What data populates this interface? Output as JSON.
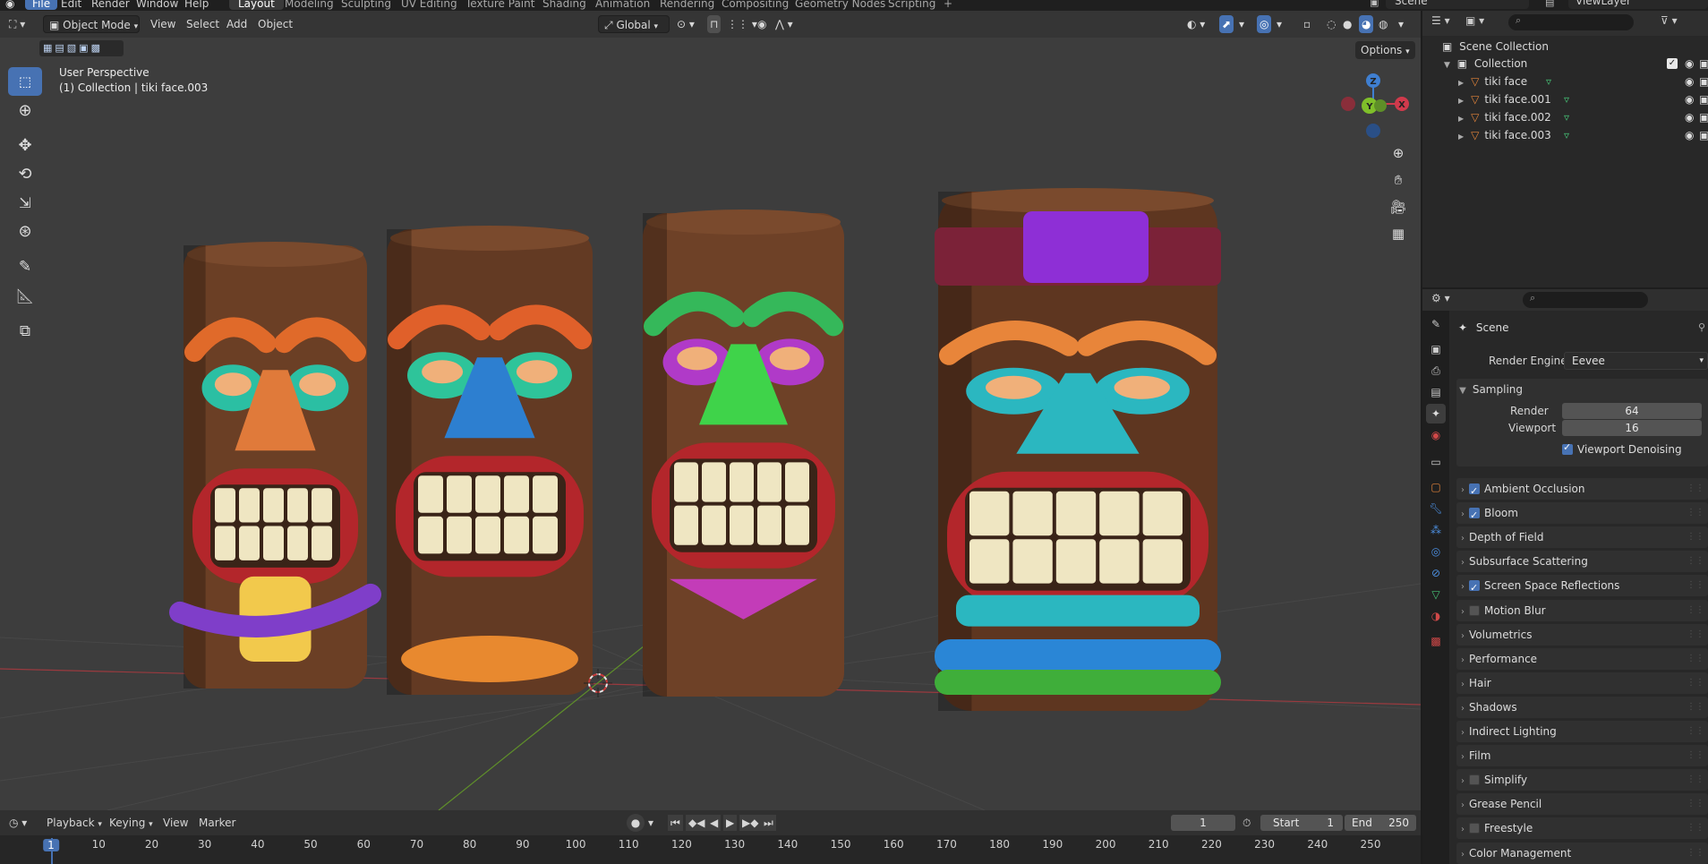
{
  "topbar": {
    "menus": [
      "File",
      "Edit",
      "Render",
      "Window",
      "Help"
    ],
    "workspaces": [
      "Layout",
      "Modeling",
      "Sculpting",
      "UV Editing",
      "Texture Paint",
      "Shading",
      "Animation",
      "Rendering",
      "Compositing",
      "Geometry Nodes",
      "Scripting"
    ],
    "active_workspace": "Layout",
    "add_workspace": "+",
    "scene_name": "Scene",
    "view_layer": "ViewLayer"
  },
  "viewport": {
    "mode": "Object Mode",
    "menus": [
      "View",
      "Select",
      "Add",
      "Object"
    ],
    "orientation": "Global",
    "options_label": "Options",
    "perspective_text": "User Perspective",
    "collection_text": "(1) Collection | tiki face.003",
    "gizmo": {
      "x": "X",
      "y": "Y",
      "z": "Z"
    },
    "tools": [
      "select-box-tool",
      "cursor-tool",
      "move-tool",
      "rotate-tool",
      "scale-tool",
      "transform-tool",
      "annotate-tool",
      "measure-tool",
      "add-cube-tool"
    ],
    "totems": [
      {
        "name": "tiki face",
        "wood": "#6b3f25",
        "brow": "#e06a2a",
        "eyes": "#2bbfa3",
        "nose": "#e07a3a",
        "lips": "#b3262b",
        "accent": "#7f3ec9",
        "chin": "#f2c94c"
      },
      {
        "name": "tiki face.001",
        "wood": "#633a23",
        "brow": "#e0602a",
        "eyes": "#2ec49a",
        "nose": "#2d7fd0",
        "lips": "#b3262b",
        "accent": "#e8892f",
        "chin": "#e8892f"
      },
      {
        "name": "tiki face.002",
        "wood": "#6e4127",
        "brow": "#35b85a",
        "eyes": "#b03ac8",
        "nose": "#3fd34a",
        "lips": "#b3262b",
        "accent": "#b03ac8",
        "chin": "#c33cb8"
      },
      {
        "name": "tiki face.003",
        "wood": "#5e3620",
        "brow": "#e8853a",
        "eyes": "#2bb7c0",
        "nose": "#2bb7c0",
        "lips": "#b3262b",
        "accent": "#8e2fd6",
        "chin": "#2a86d6"
      }
    ]
  },
  "outliner": {
    "root": "Scene Collection",
    "collection": "Collection",
    "objects": [
      "tiki face",
      "tiki face.001",
      "tiki face.002",
      "tiki face.003"
    ]
  },
  "properties": {
    "context": "Scene",
    "render_engine_label": "Render Engine",
    "render_engine": "Eevee",
    "sampling": {
      "title": "Sampling",
      "render_label": "Render",
      "render_value": "64",
      "viewport_label": "Viewport",
      "viewport_value": "16",
      "denoise_label": "Viewport Denoising"
    },
    "panels": [
      {
        "label": "Ambient Occlusion",
        "checkbox": "on"
      },
      {
        "label": "Bloom",
        "checkbox": "on"
      },
      {
        "label": "Depth of Field",
        "checkbox": "none"
      },
      {
        "label": "Subsurface Scattering",
        "checkbox": "none"
      },
      {
        "label": "Screen Space Reflections",
        "checkbox": "on"
      },
      {
        "label": "Motion Blur",
        "checkbox": "off"
      },
      {
        "label": "Volumetrics",
        "checkbox": "none"
      },
      {
        "label": "Performance",
        "checkbox": "none"
      },
      {
        "label": "Hair",
        "checkbox": "none"
      },
      {
        "label": "Shadows",
        "checkbox": "none"
      },
      {
        "label": "Indirect Lighting",
        "checkbox": "none"
      },
      {
        "label": "Film",
        "checkbox": "none"
      },
      {
        "label": "Simplify",
        "checkbox": "off"
      },
      {
        "label": "Grease Pencil",
        "checkbox": "none"
      },
      {
        "label": "Freestyle",
        "checkbox": "off"
      },
      {
        "label": "Color Management",
        "checkbox": "none"
      }
    ]
  },
  "timeline": {
    "menus": [
      "Playback",
      "Keying",
      "View",
      "Marker"
    ],
    "current_frame": "1",
    "start_label": "Start",
    "start_value": "1",
    "end_label": "End",
    "end_value": "250",
    "ruler": [
      "1",
      "10",
      "20",
      "30",
      "40",
      "50",
      "60",
      "70",
      "80",
      "90",
      "100",
      "110",
      "120",
      "130",
      "140",
      "150",
      "160",
      "170",
      "180",
      "190",
      "200",
      "210",
      "220",
      "230",
      "240",
      "250"
    ]
  },
  "colors": {
    "accent": "#4772b3",
    "axis_x": "#d13a4c",
    "axis_y": "#7fbf2a",
    "axis_z": "#3f7fd1",
    "mesh_icon": "#e0833a",
    "data_icon": "#46c276"
  }
}
